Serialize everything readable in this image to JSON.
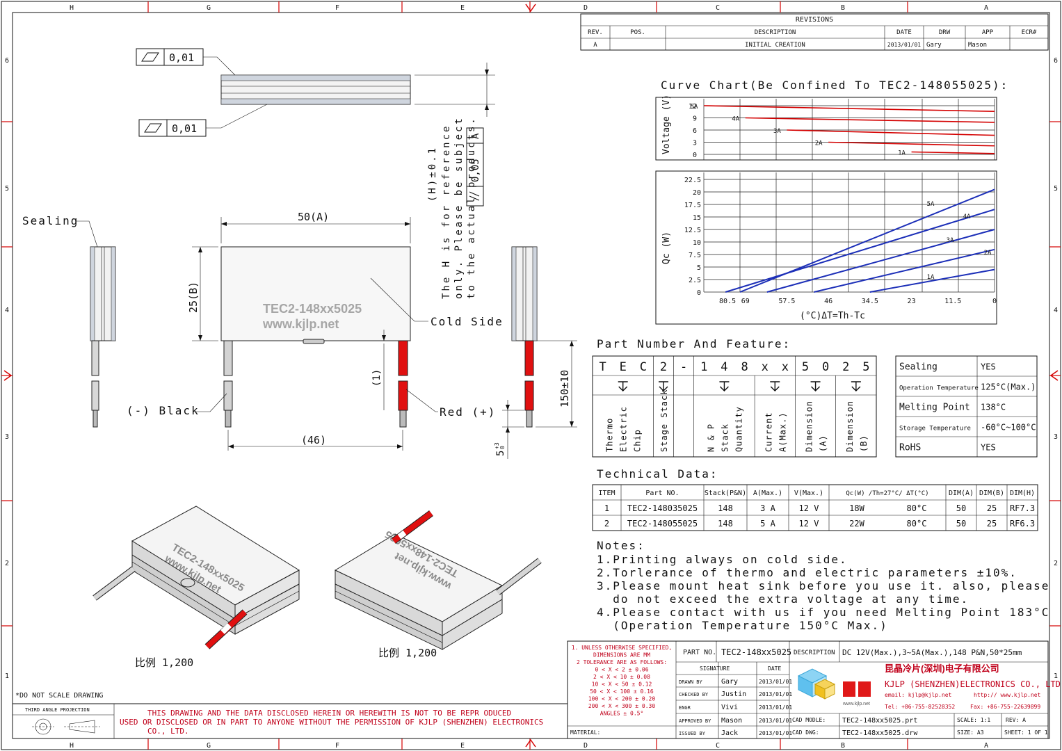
{
  "frame": {
    "col_labels": [
      "H",
      "G",
      "F",
      "E",
      "D",
      "C",
      "B",
      "A"
    ],
    "row_labels": [
      "6",
      "5",
      "4",
      "3",
      "2",
      "1"
    ]
  },
  "revisions": {
    "title": "REVISIONS",
    "headers": [
      "REV.",
      "POS.",
      "DESCRIPTION",
      "DATE",
      "DRW",
      "APP",
      "ECR#"
    ],
    "row": [
      "A",
      "",
      "INITIAL CREATION",
      "2013/01/01",
      "Gary",
      "Mason",
      ""
    ]
  },
  "drawing": {
    "flatness_top": "0,01",
    "flatness_bottom": "0,01",
    "parallel_tol": "0,05",
    "parallel_ref": "A",
    "h_note_lines": [
      "(H)±0.1",
      "The H is for reference",
      "only. Please be subject",
      "to the actual products."
    ],
    "dim_width": "50(A)",
    "dim_height": "25(B)",
    "dim_lead_spacing": "(46)",
    "dim_lead_len": "150±10",
    "dim_gap": "(1)",
    "dim_strip": "5",
    "dim_strip_tol": "+3",
    "dim_strip_tol2": "0",
    "label_sealing": "Sealing",
    "label_cold": "Cold Side",
    "label_black": "(-) Black",
    "label_red": "Red (+)",
    "print_line1": "TEC2-148xx5025",
    "print_line2": "www.kjlp.net",
    "scale_label_1": "比例 1,200",
    "scale_label_2": "比例 1,200"
  },
  "chart_title": "Curve Chart(Be Confined To TEC2-148055025):",
  "chart_data": [
    {
      "type": "line",
      "ylabel": "Voltage (V)",
      "yticks": [
        12,
        9,
        6,
        3,
        0
      ],
      "series": [
        {
          "name": "5A",
          "x": [
            80.5,
            0
          ],
          "y": [
            12,
            10.6
          ]
        },
        {
          "name": "4A",
          "x": [
            69,
            0
          ],
          "y": [
            9,
            7.9
          ]
        },
        {
          "name": "3A",
          "x": [
            57.5,
            0
          ],
          "y": [
            6,
            4.7
          ]
        },
        {
          "name": "2A",
          "x": [
            46,
            0
          ],
          "y": [
            3,
            2.1
          ]
        },
        {
          "name": "1A",
          "x": [
            23,
            0
          ],
          "y": [
            0.6,
            0.2
          ]
        }
      ]
    },
    {
      "type": "line",
      "xlabel": "(°C)ΔT=Th-Tc",
      "ylabel": "Qc (W)",
      "xticks": [
        80.5,
        69,
        57.5,
        46,
        34.5,
        23,
        11.5,
        0
      ],
      "yticks": [
        22.5,
        20,
        17.5,
        15,
        12.5,
        10,
        7.5,
        5,
        2.5,
        0
      ],
      "ylim": [
        0,
        22.5
      ],
      "series": [
        {
          "name": "5A",
          "x": [
            80.5,
            0
          ],
          "y": [
            0,
            20.5
          ]
        },
        {
          "name": "4A",
          "x": [
            74.5,
            0
          ],
          "y": [
            0,
            16.5
          ]
        },
        {
          "name": "3A",
          "x": [
            63,
            0
          ],
          "y": [
            0,
            12.5
          ]
        },
        {
          "name": "2A",
          "x": [
            50,
            0
          ],
          "y": [
            0,
            8.5
          ]
        },
        {
          "name": "1A",
          "x": [
            34.5,
            0
          ],
          "y": [
            0,
            4.5
          ]
        }
      ]
    }
  ],
  "part_feature": {
    "title": "Part Number And Feature:",
    "chars": [
      "T",
      "E",
      "C",
      "2",
      "-",
      "1",
      "4",
      "8",
      "x",
      "x",
      "5",
      "0",
      "2",
      "5"
    ],
    "desc": [
      [
        "Thermo",
        "Electric",
        "Chip"
      ],
      [
        "Stage Stack"
      ],
      [
        "N & P",
        "Stack",
        "Quantity"
      ],
      [
        "Current",
        "A(Max.)"
      ],
      [
        "Dimension",
        "(A)"
      ],
      [
        "Dimension",
        "(B)"
      ]
    ],
    "spec_rows": [
      {
        "label": "Sealing",
        "value": "YES"
      },
      {
        "label": "Operation Temperature",
        "value": "125°C(Max.)"
      },
      {
        "label": "Melting Point",
        "value": "138°C"
      },
      {
        "label": "Storage Temperature",
        "value": "-60°C~100°C"
      },
      {
        "label": "RoHS",
        "value": "YES"
      }
    ]
  },
  "technical": {
    "title": "Technical Data:",
    "headers": [
      "ITEM",
      "Part NO.",
      "Stack(P&N)",
      "A(Max.)",
      "V(Max.)",
      "Qc(W) /Th=27°C/ ΔT(°C)",
      "DIM(A)",
      "DIM(B)",
      "DIM(H)"
    ],
    "rows": [
      [
        "1",
        "TEC2-148035025",
        "148",
        "3 A",
        "12 V",
        "18W",
        "80°C",
        "50",
        "25",
        "RF7.3"
      ],
      [
        "2",
        "TEC2-148055025",
        "148",
        "5 A",
        "12 V",
        "22W",
        "80°C",
        "50",
        "25",
        "RF6.3"
      ]
    ]
  },
  "notes": {
    "title": "Notes:",
    "lines": [
      "1.Printing always on cold side.",
      "2.Torlerance of thermo and electric parameters ±10%.",
      "3.Please mount heat sink before you use it. also, please",
      "  do not exceed the extra voltage at any time.",
      "4.Please contact with us if you need Melting Point 183°C",
      "  (Operation Temperature 150°C Max.)"
    ]
  },
  "title_block": {
    "tolerance_lines": [
      "1. UNLESS OTHERWISE SPECIFIED,",
      "DIMENSIONS ARE MM",
      "2 TOLERANCE ARE AS FOLLOWS:",
      "0 < X <   2  ± 0.06",
      "2 < X <  10  ± 0.08",
      "10 < X <  50  ± 0.12",
      "50 < X < 100  ± 0.16",
      "100 < X < 200  ± 0.20",
      "200 < X < 300  ± 0.30",
      "ANGLES ± 0.5°"
    ],
    "part_no_label": "PART NO.",
    "part_no": "TEC2-148xx5025",
    "description_label": "DESCRIPTION",
    "description": "DC 12V(Max.),3~5A(Max.),148 P&N,50*25mm",
    "signature_label": "SIGNATURE",
    "date_label": "DATE",
    "sign_rows": [
      {
        "role": "DRAWN BY",
        "name": "Gary",
        "date": "2013/01/01"
      },
      {
        "role": "CHECKED BY",
        "name": "Justin",
        "date": "2013/01/01"
      },
      {
        "role": "ENGR",
        "name": "Vivi",
        "date": "2013/01/01"
      },
      {
        "role": "APPROVED BY",
        "name": "Mason",
        "date": "2013/01/01"
      },
      {
        "role": "ISSUED BY",
        "name": "Jack",
        "date": "2013/01/01"
      }
    ],
    "company_cn": "昆晶冷片(深圳)电子有限公司",
    "company_en": "KJLP (SHENZHEN)ELECTRONICS CO., LTD",
    "email": "email: kjlp@kjlp.net",
    "web": "http:// www.kjlp.net",
    "tel": "Tel: +86-755-82528352",
    "fax": "Fax: +86-755-22639899",
    "logo_text": "www.kjlp.net",
    "cad_model_label": "CAD MODLE:",
    "cad_model": "TEC2-148xx5025.prt",
    "cad_dwg_label": "CAD DWG:",
    "cad_dwg": "TEC2-148xx5025.drw",
    "scale_label": "SCALE: 1:1",
    "size_label": "SIZE: A3",
    "rev_label": "REV: A",
    "sheet_label": "SHEET: 1 OF 1",
    "material_label": "MATERIAL:",
    "no_scale": "*DO NOT SCALE DRAWING",
    "projection": "THIRD ANGLE PROJECTION",
    "disclaimer_lines": [
      "THIS DRAWING AND THE DATA DISCLOSED HEREIN OR HEREWITH IS NOT TO BE REPR ODUCED",
      "USED OR DISCLOSED OR IN PART TO ANYONE WITHOUT THE PERMISSION OF KJLP (SHENZHEN) ELECTRONICS",
      "CO., LTD."
    ]
  }
}
